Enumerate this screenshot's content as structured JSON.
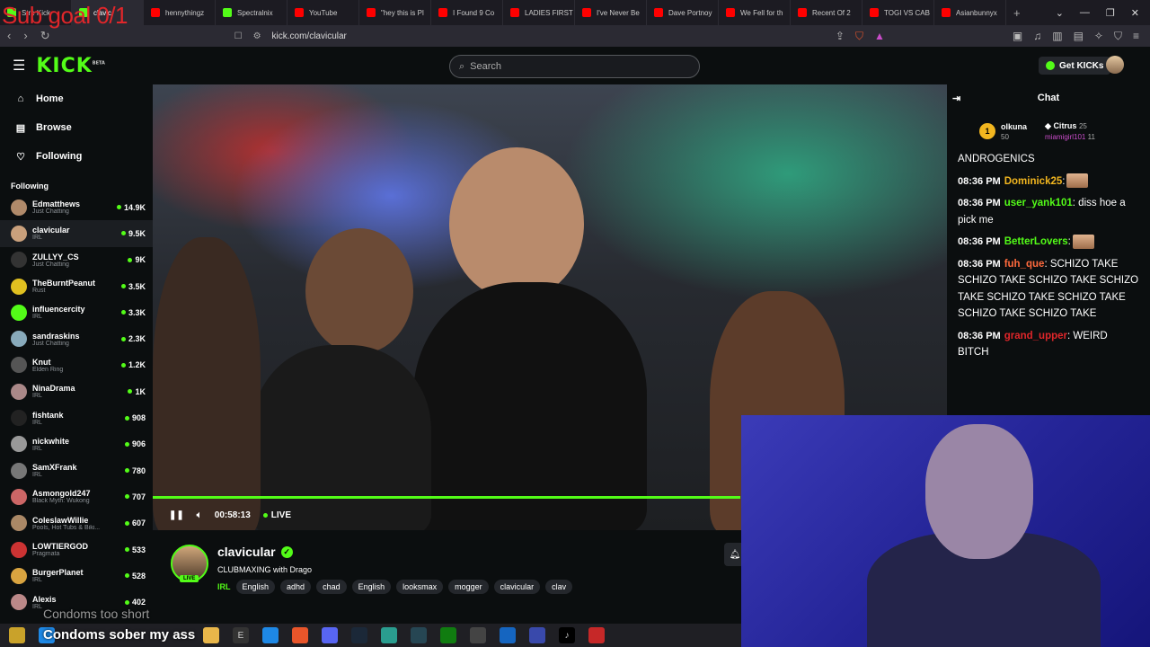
{
  "overlay": {
    "text": "Sub goal 0/1"
  },
  "browser": {
    "tabs": [
      {
        "label": "Stre Kick",
        "color": "#53fc18"
      },
      {
        "label": "clavic",
        "color": "#53fc18"
      },
      {
        "label": "hennythingz",
        "color": "#ff0000"
      },
      {
        "label": "Spectralnix",
        "color": "#53fc18"
      },
      {
        "label": "YouTube",
        "color": "#ff0000"
      },
      {
        "label": "\"hey this is Pl",
        "color": "#ff0000"
      },
      {
        "label": "I Found 9 Co",
        "color": "#ff0000"
      },
      {
        "label": "LADIES FIRST",
        "color": "#ff0000"
      },
      {
        "label": "I've Never Be",
        "color": "#ff0000"
      },
      {
        "label": "Dave Portnoy",
        "color": "#ff0000"
      },
      {
        "label": "We Fell for th",
        "color": "#ff0000"
      },
      {
        "label": "Recent Of 2",
        "color": "#ff0000"
      },
      {
        "label": "TOGI VS CAB",
        "color": "#ff0000"
      },
      {
        "label": "Asianbunnyx",
        "color": "#ff0000"
      }
    ],
    "new_tab": "+",
    "url": "kick.com/clavicular"
  },
  "header": {
    "logo": "KICK",
    "logo_beta": "BETA",
    "search_placeholder": "Search",
    "get_kicks": "Get KICKs"
  },
  "sidebar": {
    "nav": [
      {
        "label": "Home",
        "icon": "⌂"
      },
      {
        "label": "Browse",
        "icon": "▤"
      },
      {
        "label": "Following",
        "icon": "♡"
      }
    ],
    "following_heading": "Following",
    "channels": [
      {
        "name": "Edmatthews",
        "category": "Just Chatting",
        "viewers": "14.9K",
        "color": "#b08a6a"
      },
      {
        "name": "clavicular",
        "category": "IRL",
        "viewers": "9.5K",
        "color": "#c9a07c"
      },
      {
        "name": "ZULLYY_CS",
        "category": "Just Chatting",
        "viewers": "9K",
        "color": "#333"
      },
      {
        "name": "TheBurntPeanut",
        "category": "Rust",
        "viewers": "3.5K",
        "color": "#e0c020"
      },
      {
        "name": "influencercity",
        "category": "IRL",
        "viewers": "3.3K",
        "color": "#53fc18"
      },
      {
        "name": "sandraskins",
        "category": "Just Chatting",
        "viewers": "2.3K",
        "color": "#8ab"
      },
      {
        "name": "Knut",
        "category": "Elden Ring",
        "viewers": "1.2K",
        "color": "#555"
      },
      {
        "name": "NinaDrama",
        "category": "IRL",
        "viewers": "1K",
        "color": "#a88"
      },
      {
        "name": "fishtank",
        "category": "IRL",
        "viewers": "908",
        "color": "#222"
      },
      {
        "name": "nickwhite",
        "category": "IRL",
        "viewers": "906",
        "color": "#999"
      },
      {
        "name": "SamXFrank",
        "category": "IRL",
        "viewers": "780",
        "color": "#777"
      },
      {
        "name": "Asmongold247",
        "category": "Black Myth: Wukong",
        "viewers": "707",
        "color": "#c66"
      },
      {
        "name": "ColeslawWillie",
        "category": "Pools, Hot Tubs & Biki...",
        "viewers": "607",
        "color": "#a86"
      },
      {
        "name": "LOWTIERGOD",
        "category": "Pragmata",
        "viewers": "533",
        "color": "#c33"
      },
      {
        "name": "BurgerPlanet",
        "category": "IRL",
        "viewers": "528",
        "color": "#d9a440"
      },
      {
        "name": "Alexis",
        "category": "IRL",
        "viewers": "402",
        "color": "#b88"
      }
    ]
  },
  "player": {
    "time": "00:58:13",
    "live": "LIVE",
    "progress": 1.0
  },
  "stream": {
    "name": "clavicular",
    "title": "CLUBMAXING with Drago",
    "live_badge": "LIVE",
    "category": "IRL",
    "tags": [
      "English",
      "adhd",
      "chad",
      "English",
      "looksmax",
      "mogger",
      "clavicular",
      "clav"
    ]
  },
  "chat": {
    "title": "Chat",
    "leaderboard": [
      {
        "rank": "1",
        "name": "olkuna",
        "value": "50"
      },
      {
        "name": "Citrus",
        "value": "25"
      },
      {
        "name": "miamigirl101",
        "value": "11"
      }
    ],
    "messages": [
      {
        "time": "",
        "user": "",
        "user_color": "#ffffff",
        "text": "ANDROGENICS"
      },
      {
        "time": "08:36 PM",
        "user": "Dominick25",
        "user_color": "#f2b61f",
        "text": ":"
      },
      {
        "time": "08:36 PM",
        "user": "user_yank101",
        "user_color": "#53fc18",
        "text": ": diss hoe a pick me"
      },
      {
        "time": "08:36 PM",
        "user": "BetterLovers",
        "user_color": "#53fc18",
        "text": ":"
      },
      {
        "time": "08:36 PM",
        "user": "fuh_que",
        "user_color": "#ff6a3d",
        "text": ": SCHIZO TAKE SCHIZO TAKE SCHIZO TAKE SCHIZO TAKE SCHIZO TAKE SCHIZO TAKE SCHIZO TAKE SCHIZO TAKE"
      },
      {
        "time": "08:36 PM",
        "user": "grand_upper",
        "user_color": "#e0262a",
        "text": ": WEIRD BITCH"
      }
    ]
  },
  "captions": {
    "line1": "Condoms too short",
    "line2": "Condoms sober my ass"
  }
}
